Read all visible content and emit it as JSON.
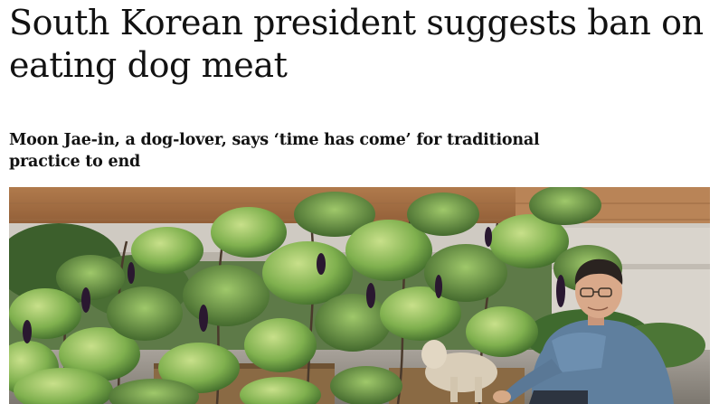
{
  "article": {
    "headline": "South Korean president suggests ban on eating dog meat",
    "standfirst": "Moon Jae-in, a dog-lover, says ‘time has come’ for traditional practice to end",
    "image": {
      "icon": "photo-garden-president-with-dog"
    }
  }
}
